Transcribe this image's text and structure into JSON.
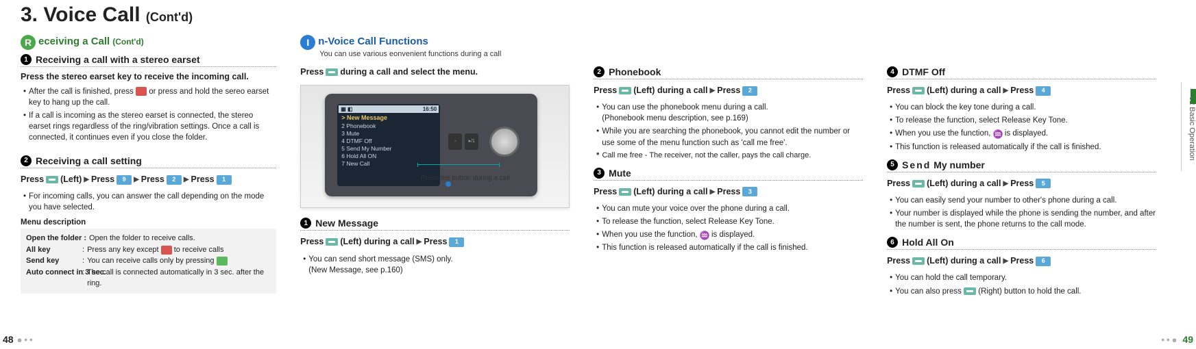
{
  "page_title": {
    "num": "3.",
    "main": "Voice Call",
    "contd": "(Cont'd)"
  },
  "side_tab": "02  Basic Operation",
  "page_left": "48",
  "page_right": "49",
  "receiving": {
    "letter": "R",
    "title": "eceiving a Call",
    "contd": "(Cont'd)",
    "item1": {
      "num": "1",
      "title": "Receiving a call with a stereo earset",
      "bold": "Press the stereo earset key to receive the incoming call.",
      "b1": "After the call is finished, press",
      "b1b": "or press and hold the sereo earset key to hang up the call.",
      "b2": "If a call is incoming as the stereo earset is connected, the stereo earset rings regardless of the ring/vibration settings.  Once a call is connected, it continues even if you close the folder."
    },
    "item2": {
      "num": "2",
      "title": "Receiving a call setting",
      "press": {
        "p": "Press",
        "left": "(Left)",
        "k1": "9",
        "k2": "2",
        "k3": "1"
      },
      "b1": "For incoming calls, you can answer the call depending on the mode you have selected.",
      "menu_head": "Menu description",
      "rows": [
        {
          "k": "Open the folder :",
          "v": "Open the folder to receive calls."
        },
        {
          "k": "All key",
          "c": ":",
          "v_pre": "Press any key except",
          "v_post": "to receive calls"
        },
        {
          "k": "Send key",
          "c": ":",
          "v_pre": "You can receive calls only by pressing",
          "v_post": ""
        },
        {
          "k": "Auto connect in 3 sec.",
          "c": ":",
          "v": "The call is connected automatically in 3 sec. after the ring."
        }
      ]
    }
  },
  "invoice": {
    "letter": "I",
    "title": "n-Voice Call Functions",
    "sub": "You can use various eonvenient functions during a call",
    "press_intro": {
      "p": "Press",
      "rest": "during a call and select the menu."
    },
    "shot": {
      "time": "16:50",
      "sig": "▦ ◧",
      "head": "> New Message",
      "items": [
        "2 Phonebook",
        "3 Mute",
        "4 DTMF Off",
        "5 Send My Number",
        "6 Hold All ON",
        "7 New Call"
      ],
      "caption": "Press the button during a call"
    },
    "newmsg": {
      "num": "1",
      "title": "New Message",
      "press": {
        "p": "Press",
        "left": "(Left) during a call",
        "k": "1"
      },
      "b1": "You can send short message (SMS) only.",
      "b1s": "(New Message, see p.160)"
    }
  },
  "col3": {
    "pb": {
      "num": "2",
      "title": "Phonebook",
      "press": {
        "p": "Press",
        "left": "(Left) during a call",
        "k": "2"
      },
      "b1": "You can use the phonebook menu during a call.",
      "b1s": "(Phonebook menu description, see p.169)",
      "b2": "While you are searching the phonebook, you cannot edit the number or use some of the menu function such as 'call me free'.",
      "note": "Call me free - The receiver, not the caller, pays the call charge."
    },
    "mute": {
      "num": "3",
      "title": "Mute",
      "press": {
        "p": "Press",
        "left": "(Left) during a call",
        "k": "3"
      },
      "b1": "You can mute your voice over the phone during a call.",
      "b2": "To release the function, select Release Key Tone.",
      "b3a": "When you use the function,",
      "b3b": "is displayed.",
      "b4": "This function is released automatically if the call is finished."
    }
  },
  "col4": {
    "dtmf": {
      "num": "4",
      "title": "DTMF Off",
      "press": {
        "p": "Press",
        "left": "(Left) during a call",
        "k": "4"
      },
      "b1": "You can block the key tone during a call.",
      "b2": "To release the function, select Release Key Tone.",
      "b3a": "When you use the function,",
      "b3b": "is displayed.",
      "b4": "This function is released automatically if the call is finished."
    },
    "send": {
      "num": "5",
      "title_send": "Send",
      "title_rest": "My number",
      "press": {
        "p": "Press",
        "left": "(Left) during a call",
        "k": "5"
      },
      "b1": "You can easily send your number to other's phone during a call.",
      "b2": "Your number is displayed while the phone is sending the number, and after the number is sent, the phone returns to the call mode."
    },
    "hold": {
      "num": "6",
      "title": "Hold All On",
      "press": {
        "p": "Press",
        "left": "(Left) during a call",
        "k": "6"
      },
      "b1": "You can hold the call temporary.",
      "b2a": "You can also press",
      "b2b": "(Right) button to hold the call."
    }
  }
}
